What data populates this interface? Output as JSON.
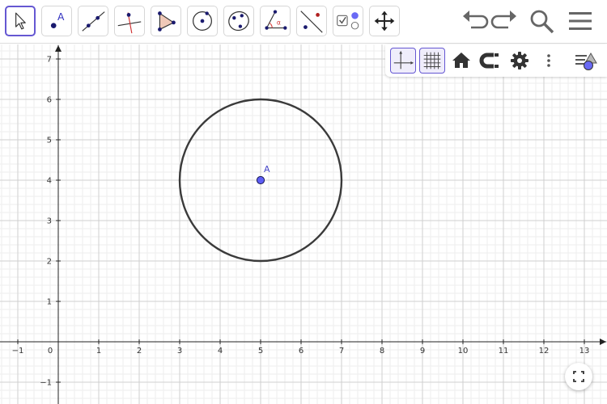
{
  "toolbar": {
    "tools": [
      {
        "name": "move-tool",
        "icon": "arrow-pointer-icon",
        "selected": true
      },
      {
        "name": "point-tool",
        "icon": "point-icon",
        "label": "A"
      },
      {
        "name": "line-tool",
        "icon": "line-icon"
      },
      {
        "name": "perpendicular-line-tool",
        "icon": "perpendicular-line-icon"
      },
      {
        "name": "polygon-tool",
        "icon": "polygon-icon"
      },
      {
        "name": "circle-center-point-tool",
        "icon": "circle-center-icon"
      },
      {
        "name": "circle-three-points-tool",
        "icon": "circle-three-points-icon"
      },
      {
        "name": "angle-tool",
        "icon": "angle-icon",
        "label": "α"
      },
      {
        "name": "reflect-tool",
        "icon": "reflect-icon"
      },
      {
        "name": "checkbox-tool",
        "icon": "checkbox-icon"
      },
      {
        "name": "move-graphics-view-tool",
        "icon": "move-cross-icon"
      }
    ],
    "right": [
      "undo-icon",
      "redo-icon",
      "search-icon",
      "menu-icon"
    ]
  },
  "style_bar": {
    "buttons": [
      "axes-icon",
      "grid-icon",
      "home-icon",
      "magnet-icon",
      "gear-icon",
      "more-vert-icon",
      "style-bar-toggle-icon"
    ]
  },
  "graphics": {
    "x_ticks": [
      "−1",
      "0",
      "1",
      "2",
      "3",
      "4",
      "5",
      "6",
      "7",
      "8",
      "9",
      "10",
      "11",
      "12",
      "13"
    ],
    "y_ticks": [
      "−1",
      "1",
      "2",
      "3",
      "4",
      "5",
      "6",
      "7"
    ],
    "point": {
      "label": "A",
      "x": 5,
      "y": 4
    },
    "circle": {
      "center_x": 5,
      "center_y": 4,
      "radius": 2
    },
    "colors": {
      "point_fill": "#5d5df5",
      "point_label": "#4747c8",
      "circle_stroke": "#3a3a3a",
      "accent": "#6557d2"
    }
  }
}
